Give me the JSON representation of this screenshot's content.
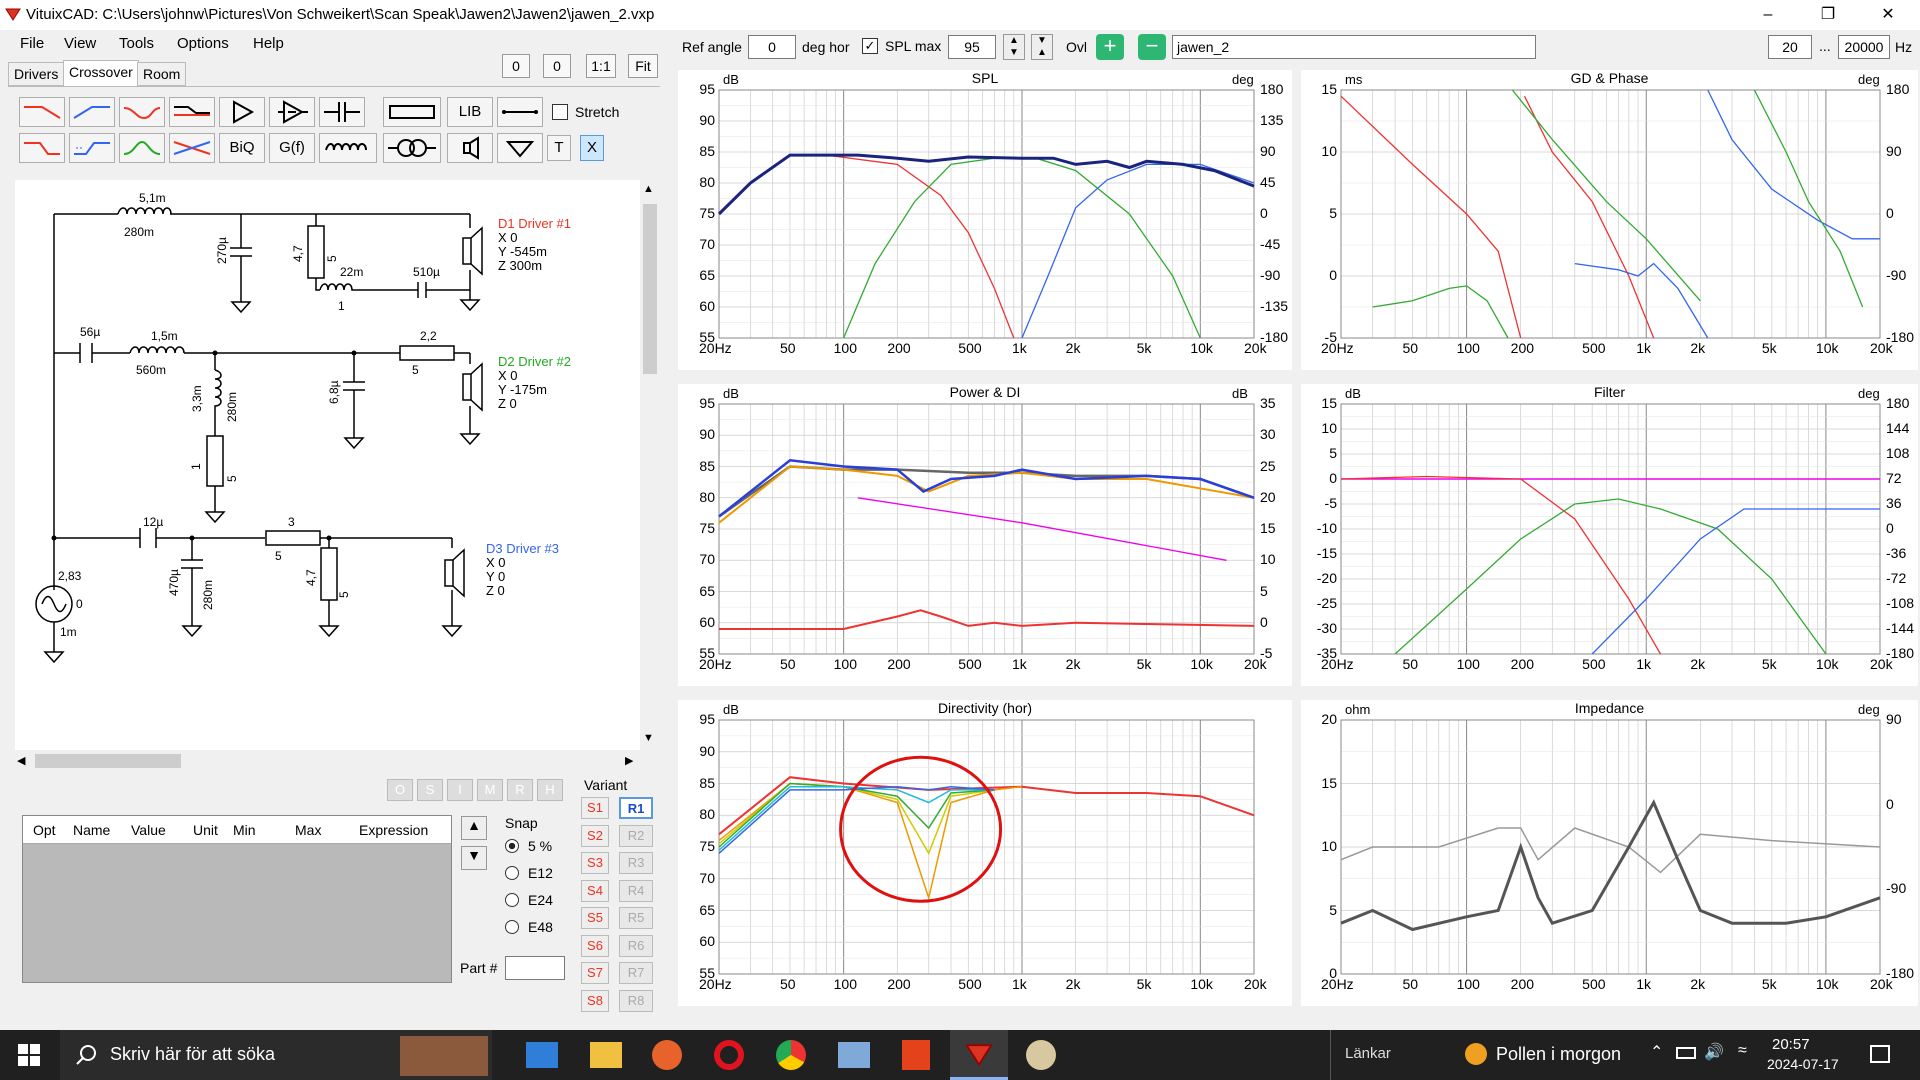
{
  "window": {
    "title": "VituixCAD: C:\\Users\\johnw\\Pictures\\Von Schweikert\\Scan Speak\\Jawen2\\Jawen2\\jawen_2.vxp",
    "minimize": "–",
    "maximize": "❐",
    "close": "✕"
  },
  "menu": [
    "File",
    "View",
    "Tools",
    "Options",
    "Help"
  ],
  "tabs": [
    "Drivers",
    "Crossover",
    "Room"
  ],
  "topbuttons": {
    "b1": "0",
    "b2": "0",
    "b3": "1:1",
    "b4": "Fit"
  },
  "toolbar": {
    "lib": "LIB",
    "biq": "BiQ",
    "gf": "G(f)",
    "t": "T",
    "x": "X",
    "stretch": "Stretch"
  },
  "controls": {
    "ref_angle_label": "Ref angle",
    "ref_angle": "0",
    "deg_hor": "deg hor",
    "splmax_label": "SPL max",
    "splmax": "95",
    "ovl": "Ovl",
    "variant_name": "jawen_2",
    "f_min": "20",
    "dots": "...",
    "f_max": "20000",
    "hz": "Hz"
  },
  "schematic": {
    "d1": {
      "title": "D1 Driver #1",
      "x": "X 0",
      "y": "Y -545m",
      "z": "Z 300m"
    },
    "d2": {
      "title": "D2 Driver #2",
      "x": "X 0",
      "y": "Y -175m",
      "z": "Z 0"
    },
    "d3": {
      "title": "D3 Driver #3",
      "x": "X 0",
      "y": "Y 0",
      "z": "Z 0"
    },
    "labels": {
      "l1": "5,1m",
      "l1r": "280m",
      "c1": "270µ",
      "r1": "4,7",
      "r1b": "5",
      "l2": "22m",
      "l2r": "1",
      "c2": "510µ",
      "c3": "56µ",
      "l3": "1,5m",
      "l3r": "560m",
      "l4": "3,3m",
      "l4r": "280m",
      "r2": "1",
      "r2b": "5",
      "r3": "2,2",
      "r3b": "5",
      "c4": "6,8µ",
      "c5": "12µ",
      "c6": "470µ",
      "c6r": "280m",
      "r4": "3",
      "r4b": "5",
      "r5": "4,7",
      "r5b": "5",
      "src_v": "2,83",
      "src_z": "0",
      "src_r": "1m"
    }
  },
  "opts": [
    "O",
    "S",
    "I",
    "M",
    "R",
    "H"
  ],
  "table_headers": [
    "Opt",
    "Name",
    "Value",
    "Unit",
    "Min",
    "Max",
    "Expression"
  ],
  "snap": {
    "label": "Snap",
    "options": [
      "5 %",
      "E12",
      "E24",
      "E48"
    ],
    "selected": 0
  },
  "part_label": "Part #",
  "variant": {
    "label": "Variant",
    "s": [
      "S1",
      "S2",
      "S3",
      "S4",
      "S5",
      "S6",
      "S7",
      "S8"
    ],
    "r": [
      "R1",
      "R2",
      "R3",
      "R4",
      "R5",
      "R6",
      "R7",
      "R8"
    ]
  },
  "charts": {
    "spl": {
      "title": "SPL",
      "yl": "dB",
      "yr": "deg",
      "left": [
        "95",
        "90",
        "85",
        "80",
        "75",
        "70",
        "65",
        "60",
        "55"
      ],
      "right": [
        "180",
        "135",
        "90",
        "45",
        "0",
        "-45",
        "-90",
        "-135",
        "-180"
      ]
    },
    "gd": {
      "title": "GD & Phase",
      "yl": "ms",
      "yr": "deg",
      "left": [
        "15",
        "10",
        "5",
        "0",
        "-5"
      ],
      "right": [
        "180",
        "90",
        "0",
        "-90",
        "-180"
      ]
    },
    "pwr": {
      "title": "Power & DI",
      "yl": "dB",
      "yr": "dB",
      "left": [
        "95",
        "90",
        "85",
        "80",
        "75",
        "70",
        "65",
        "60",
        "55"
      ],
      "right": [
        "35",
        "30",
        "25",
        "20",
        "15",
        "10",
        "5",
        "0",
        "-5"
      ]
    },
    "flt": {
      "title": "Filter",
      "yl": "dB",
      "yr": "deg",
      "left": [
        "15",
        "10",
        "5",
        "0",
        "-5",
        "-10",
        "-15",
        "-20",
        "-25",
        "-30",
        "-35"
      ],
      "right": [
        "180",
        "144",
        "108",
        "72",
        "36",
        "0",
        "-36",
        "-72",
        "-108",
        "-144",
        "-180"
      ]
    },
    "dir": {
      "title": "Directivity (hor)",
      "yl": "dB",
      "left": [
        "95",
        "90",
        "85",
        "80",
        "75",
        "70",
        "65",
        "60",
        "55"
      ]
    },
    "imp": {
      "title": "Impedance",
      "yl": "ohm",
      "yr": "deg",
      "left": [
        "20",
        "15",
        "10",
        "5",
        "0"
      ],
      "right": [
        "90",
        "0",
        "-90",
        "-180"
      ]
    },
    "xticks": [
      "20Hz",
      "50",
      "100",
      "200",
      "500",
      "1k",
      "2k",
      "5k",
      "10k",
      "20k"
    ]
  },
  "taskbar": {
    "search": "Skriv här för att söka",
    "links": "Länkar",
    "weather": "Pollen i morgon",
    "time": "20:57",
    "date": "2024-07-17"
  }
}
